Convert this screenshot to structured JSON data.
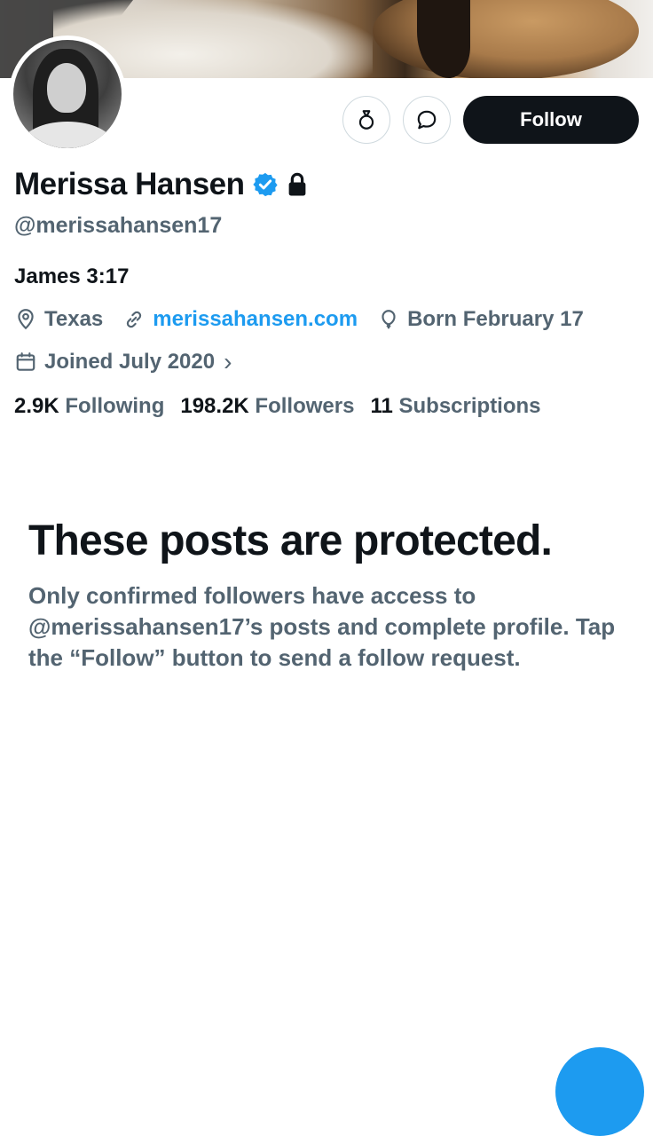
{
  "profile": {
    "name": "Merissa Hansen",
    "handle": "@merissahansen17",
    "bio": "James 3:17",
    "location": "Texas",
    "website": "merissahansen.com",
    "birthday": "Born February 17",
    "joined": "Joined July 2020",
    "joined_chevron": "›"
  },
  "actions": {
    "follow_label": "Follow"
  },
  "stats": {
    "following_count": "2.9K",
    "following_label": "Following",
    "followers_count": "198.2K",
    "followers_label": "Followers",
    "subscriptions_count": "11",
    "subscriptions_label": "Subscriptions"
  },
  "protected": {
    "title": "These posts are protected.",
    "message": "Only confirmed followers have access to @merissahansen17’s posts and complete profile. Tap the “Follow” button to send a follow request."
  },
  "colors": {
    "accent": "#1d9bf0",
    "secondary_text": "#536471",
    "primary_text": "#0f1419"
  },
  "icons": [
    "subscribe-icon",
    "message-icon",
    "verified-badge-icon",
    "lock-icon",
    "location-icon",
    "link-icon",
    "balloon-icon",
    "calendar-icon"
  ]
}
